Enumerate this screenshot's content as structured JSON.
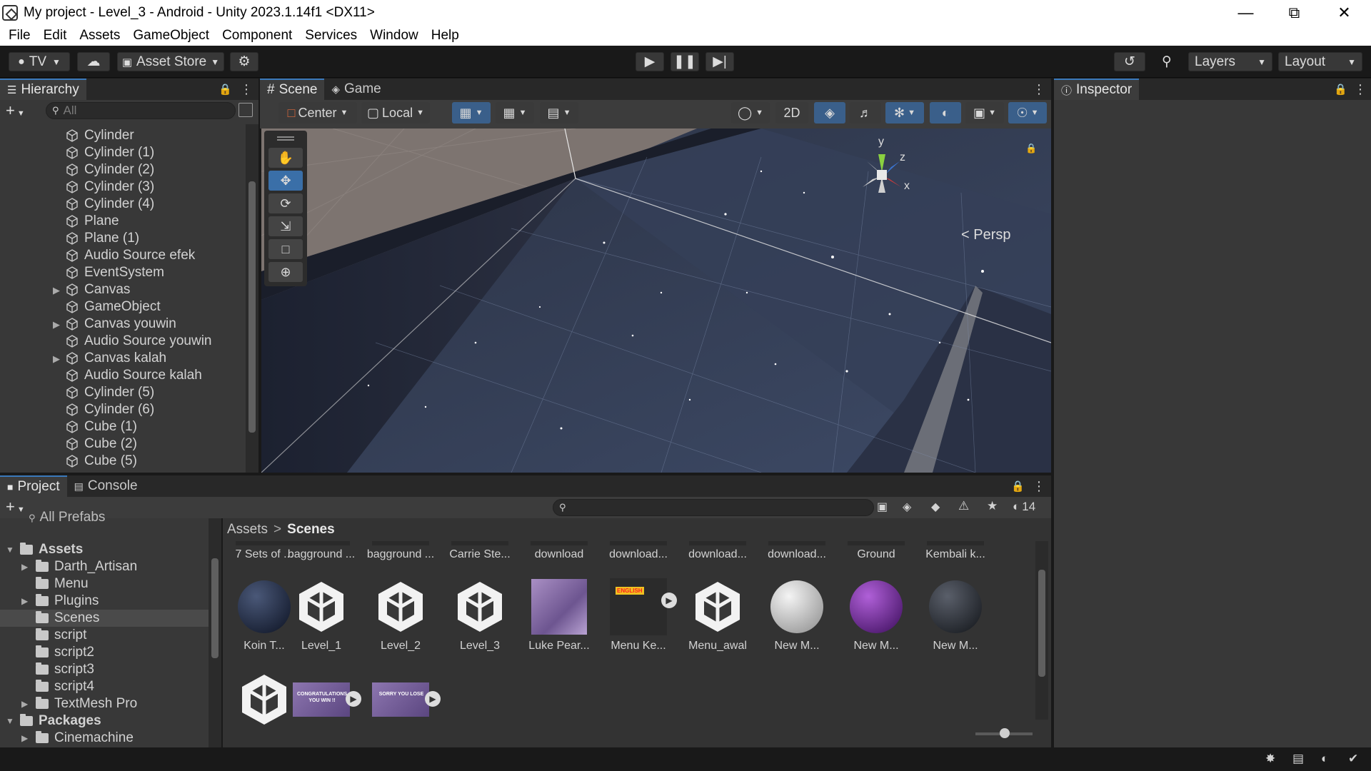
{
  "window": {
    "title": "My project - Level_3 - Android - Unity 2023.1.14f1 <DX11>"
  },
  "menu": [
    "File",
    "Edit",
    "Assets",
    "GameObject",
    "Component",
    "Services",
    "Window",
    "Help"
  ],
  "toolbar": {
    "account": "TV",
    "asset_store": "Asset Store",
    "layers": "Layers",
    "layout": "Layout"
  },
  "hierarchy": {
    "tab": "Hierarchy",
    "search_placeholder": "All",
    "items": [
      {
        "label": "Cylinder",
        "expandable": false
      },
      {
        "label": "Cylinder (1)",
        "expandable": false
      },
      {
        "label": "Cylinder (2)",
        "expandable": false
      },
      {
        "label": "Cylinder (3)",
        "expandable": false
      },
      {
        "label": "Cylinder (4)",
        "expandable": false
      },
      {
        "label": "Plane",
        "expandable": false
      },
      {
        "label": "Plane (1)",
        "expandable": false
      },
      {
        "label": "Audio Source efek",
        "expandable": false
      },
      {
        "label": "EventSystem",
        "expandable": false
      },
      {
        "label": "Canvas",
        "expandable": true
      },
      {
        "label": "GameObject",
        "expandable": false
      },
      {
        "label": "Canvas youwin",
        "expandable": true
      },
      {
        "label": "Audio Source youwin",
        "expandable": false
      },
      {
        "label": "Canvas kalah",
        "expandable": true
      },
      {
        "label": "Audio Source kalah",
        "expandable": false
      },
      {
        "label": "Cylinder (5)",
        "expandable": false
      },
      {
        "label": "Cylinder (6)",
        "expandable": false
      },
      {
        "label": "Cube (1)",
        "expandable": false
      },
      {
        "label": "Cube (2)",
        "expandable": false
      },
      {
        "label": "Cube (5)",
        "expandable": false
      }
    ]
  },
  "scene": {
    "tabs": [
      "Scene",
      "Game"
    ],
    "pivot": "Center",
    "space": "Local",
    "mode_2d": "2D",
    "persp": "Persp",
    "gizmo": {
      "x": "x",
      "y": "y",
      "z": "z"
    }
  },
  "inspector": {
    "tab": "Inspector"
  },
  "project": {
    "tabs": [
      "Project",
      "Console"
    ],
    "hidden_count": "14",
    "search_placeholder": "",
    "breadcrumb": [
      "Assets",
      "Scenes"
    ],
    "tree_top_partial": "All Prefabs",
    "tree": [
      {
        "label": "Assets",
        "level": 0,
        "expanded": true,
        "bold": true
      },
      {
        "label": "Darth_Artisan",
        "level": 1,
        "expandable": true
      },
      {
        "label": "Menu",
        "level": 1,
        "expandable": false
      },
      {
        "label": "Plugins",
        "level": 1,
        "expandable": true
      },
      {
        "label": "Scenes",
        "level": 1,
        "expandable": false,
        "selected": true
      },
      {
        "label": "script",
        "level": 1,
        "expandable": false
      },
      {
        "label": "script2",
        "level": 1,
        "expandable": false
      },
      {
        "label": "script3",
        "level": 1,
        "expandable": false
      },
      {
        "label": "script4",
        "level": 1,
        "expandable": false
      },
      {
        "label": "TextMesh Pro",
        "level": 1,
        "expandable": true
      },
      {
        "label": "Packages",
        "level": 0,
        "expanded": true,
        "bold": true
      },
      {
        "label": "Cinemachine",
        "level": 1,
        "expandable": true
      }
    ],
    "assets_row1": [
      "7 Sets of ...",
      "bagground ...",
      "bagground ...",
      "Carrie Ste...",
      "download",
      "download...",
      "download...",
      "download...",
      "Ground",
      "Kembali k..."
    ],
    "assets_row2": [
      {
        "label": "Koin T...",
        "kind": "sphere-dark"
      },
      {
        "label": "Level_1",
        "kind": "unity"
      },
      {
        "label": "Level_2",
        "kind": "unity"
      },
      {
        "label": "Level_3",
        "kind": "unity"
      },
      {
        "label": "Luke Pear...",
        "kind": "texture"
      },
      {
        "label": "Menu Ke...",
        "kind": "video",
        "badge": "ENGLISH"
      },
      {
        "label": "Menu_awal",
        "kind": "unity"
      },
      {
        "label": "New M...",
        "kind": "sphere-white"
      },
      {
        "label": "New M...",
        "kind": "sphere-purple"
      },
      {
        "label": "New M...",
        "kind": "sphere-black"
      }
    ],
    "assets_row3": [
      {
        "kind": "unity"
      },
      {
        "kind": "video",
        "badge": "CONGRATULATIONS YOU WIN !!"
      },
      {
        "kind": "video",
        "badge": "SORRY YOU LOSE"
      }
    ]
  },
  "colors": {
    "accent": "#3a79bb",
    "panel": "#383838",
    "dark": "#282828"
  }
}
